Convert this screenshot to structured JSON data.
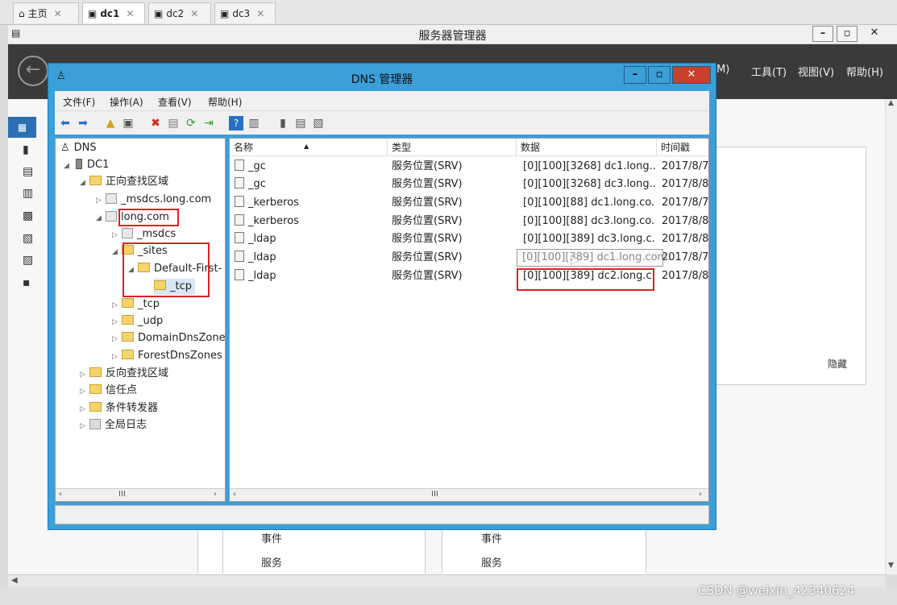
{
  "browser_tabs": [
    {
      "label": "主页",
      "active": false
    },
    {
      "label": "dc1",
      "active": true
    },
    {
      "label": "dc2",
      "active": false
    },
    {
      "label": "dc3",
      "active": false
    }
  ],
  "server_manager": {
    "title": "服务器管理器",
    "menu": [
      "(M)",
      "工具(T)",
      "视图(V)",
      "帮助(H)"
    ],
    "right_panel_hide": "隐藏",
    "tiles": [
      {
        "events": "事件",
        "services": "服务"
      },
      {
        "events": "事件",
        "services": "服务"
      }
    ]
  },
  "dns_window": {
    "title": "DNS 管理器",
    "menu": [
      "文件(F)",
      "操作(A)",
      "查看(V)",
      "帮助(H)"
    ],
    "tree": [
      {
        "label": "DNS",
        "level": 0,
        "icon": "dns-icon"
      },
      {
        "label": "DC1",
        "level": 1,
        "icon": "server-icon"
      },
      {
        "label": "正向查找区域",
        "level": 2,
        "icon": "folder-icon"
      },
      {
        "label": "_msdcs.long.com",
        "level": 3,
        "icon": "zone-icon"
      },
      {
        "label": "long.com",
        "level": 3,
        "icon": "zone-icon"
      },
      {
        "label": "_msdcs",
        "level": 4,
        "icon": "zone-icon"
      },
      {
        "label": "_sites",
        "level": 4,
        "icon": "folder-icon"
      },
      {
        "label": "Default-First-",
        "level": 5,
        "icon": "folder-icon"
      },
      {
        "label": "_tcp",
        "level": 6,
        "icon": "folder-icon"
      },
      {
        "label": "_tcp",
        "level": 4,
        "icon": "folder-icon"
      },
      {
        "label": "_udp",
        "level": 4,
        "icon": "folder-icon"
      },
      {
        "label": "DomainDnsZone",
        "level": 4,
        "icon": "folder-icon"
      },
      {
        "label": "ForestDnsZones",
        "level": 4,
        "icon": "folder-icon"
      },
      {
        "label": "反向查找区域",
        "level": 2,
        "icon": "folder-icon"
      },
      {
        "label": "信任点",
        "level": 2,
        "icon": "folder-icon"
      },
      {
        "label": "条件转发器",
        "level": 2,
        "icon": "folder-icon"
      },
      {
        "label": "全局日志",
        "level": 2,
        "icon": "log-icon"
      }
    ],
    "columns": [
      "名称",
      "类型",
      "数据",
      "时间戳"
    ],
    "rows": [
      {
        "name": "_gc",
        "type": "服务位置(SRV)",
        "data": "[0][100][3268] dc1.long....",
        "ts": "2017/8/7"
      },
      {
        "name": "_gc",
        "type": "服务位置(SRV)",
        "data": "[0][100][3268] dc3.long....",
        "ts": "2017/8/8"
      },
      {
        "name": "_kerberos",
        "type": "服务位置(SRV)",
        "data": "[0][100][88] dc1.long.co...",
        "ts": "2017/8/7"
      },
      {
        "name": "_kerberos",
        "type": "服务位置(SRV)",
        "data": "[0][100][88] dc3.long.co...",
        "ts": "2017/8/8"
      },
      {
        "name": "_ldap",
        "type": "服务位置(SRV)",
        "data": "[0][100][389] dc3.long.c...",
        "ts": "2017/8/8"
      },
      {
        "name": "_ldap",
        "type": "服务位置(SRV)",
        "data": "",
        "ts": "2017/8/7"
      },
      {
        "name": "_ldap",
        "type": "服务位置(SRV)",
        "data": "[0][100][389] dc2.long.c...",
        "ts": "2017/8/8"
      }
    ],
    "tooltip": "[0][100][389] dc1.long.com.",
    "scroll_mark": "III"
  },
  "watermark": "CSDN @weixin_42340624"
}
